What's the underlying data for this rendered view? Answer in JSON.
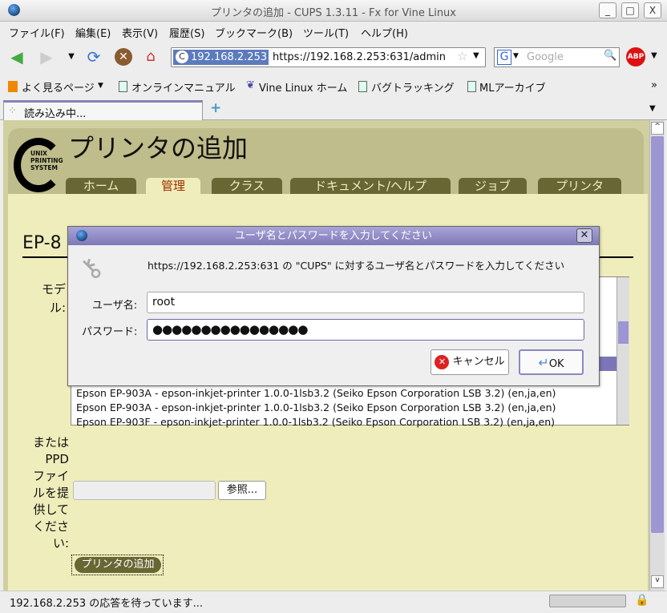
{
  "window": {
    "title": "プリンタの追加 - CUPS 1.3.11 - Fx for Vine Linux",
    "minimize": "_",
    "maximize": "□",
    "close": "X"
  },
  "menu": [
    "ファイル(F)",
    "編集(E)",
    "表示(V)",
    "履歴(S)",
    "ブックマーク(B)",
    "ツール(T)",
    "ヘルプ(H)"
  ],
  "nav": {
    "url_host": "192.168.2.253",
    "url": "https://192.168.2.253:631/admin",
    "search_engine": "G",
    "search_placeholder": "Google",
    "abp": "ABP"
  },
  "bookmarks": [
    "よく見るページ",
    "オンラインマニュアル",
    "Vine Linux ホーム",
    "バグトラッキング",
    "MLアーカイブ"
  ],
  "overflow": "»",
  "tab": {
    "label": "読み込み中...",
    "new_tab": "+"
  },
  "page": {
    "logo_lines": [
      "UNIX",
      "PRINTING",
      "SYSTEM"
    ],
    "title": "プリンタの追加",
    "tabs": [
      "ホーム",
      "管理",
      "クラス",
      "ドキュメント/ヘルプ",
      "ジョブ",
      "プリンタ"
    ],
    "active_tab": "管理",
    "heading": "EP-8",
    "model_label_1": "モデ",
    "model_label_2": "ル:",
    "models": [
      "Epson EP-903A - epson-inkjet-printer 1.0.0-1lsb3.2 (Seiko Epson Corporation LSB 3.2) (en,ja,en)",
      "Epson EP-903A - epson-inkjet-printer 1.0.0-1lsb3.2 (Seiko Epson Corporation LSB 3.2) (en,ja,en)",
      "Epson EP-903F - epson-inkjet-printer 1.0.0-1lsb3.2 (Seiko Epson Corporation LSB 3.2) (en,ja,en)"
    ],
    "ppd_label": [
      "または",
      "PPD",
      "ファイ",
      "ルを提",
      "供して",
      "くださ",
      "い:"
    ],
    "browse": "参照...",
    "add_button": "プリンタの追加"
  },
  "dialog": {
    "title": "ユーザ名とパスワードを入力してください",
    "message": "https://192.168.2.253:631 の \"CUPS\" に対するユーザ名とパスワードを入力してください",
    "user_label": "ユーザ名:",
    "user_value": "root",
    "pass_label": "パスワード:",
    "pass_value": "●●●●●●●●●●●●●●●●",
    "cancel": "キャンセル",
    "ok": "OK"
  },
  "status": {
    "text": "192.168.2.253 の応答を待っています..."
  }
}
